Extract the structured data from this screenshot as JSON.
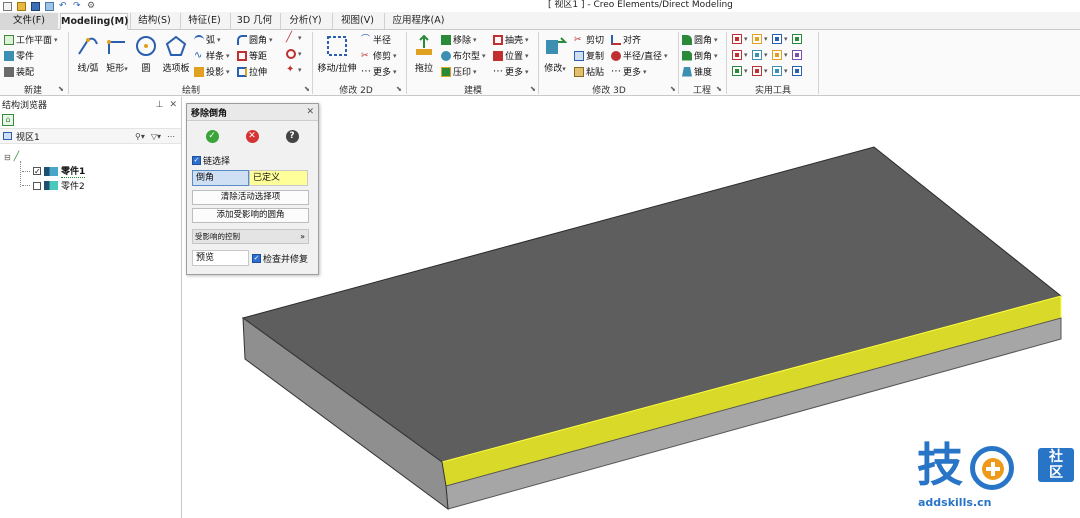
{
  "window": {
    "title": "[ 视区1 ] - Creo Elements/Direct Modeling"
  },
  "tabs": [
    {
      "label": "文件(F)"
    },
    {
      "label": "Modeling(M)"
    },
    {
      "label": "结构(S)"
    },
    {
      "label": "特征(E)"
    },
    {
      "label": "3D 几何"
    },
    {
      "label": "分析(Y)"
    },
    {
      "label": "视图(V)"
    },
    {
      "label": "应用程序(A)"
    }
  ],
  "ribbon": {
    "new": {
      "workplane": "工作平面",
      "part": "零件",
      "assembly": "装配",
      "label": "新建"
    },
    "draw": {
      "line_arc": "线/弧",
      "rectangle": "矩形",
      "circle": "圆",
      "options": "选项板",
      "arc": "弧",
      "spline": "样条",
      "project": "投影",
      "fillet": "圆角",
      "offset": "等距",
      "extrude": "拉伸",
      "label": "绘制"
    },
    "modify2d": {
      "move_stretch": "移动/拉伸",
      "radius": "半径",
      "trim": "修剪",
      "more": "更多",
      "label": "修改 2D"
    },
    "model": {
      "pull": "拖拉",
      "move": "移除",
      "boolean": "布尔型",
      "imprint": "压印",
      "shell": "抽壳",
      "position": "位置",
      "more": "更多",
      "label": "建模"
    },
    "modify3d": {
      "modify": "修改",
      "cut": "剪切",
      "copy": "复制",
      "paste": "粘贴",
      "align": "对齐",
      "radius_diameter": "半径/直径",
      "more": "更多",
      "label": "修改 3D"
    },
    "engineering": {
      "fillet": "圆角",
      "chamfer": "倒角",
      "taper": "锥度",
      "label": "工程"
    },
    "utilities": {
      "label": "实用工具"
    }
  },
  "browser": {
    "title": "结构浏览器",
    "viewport": "视区1",
    "parts": [
      {
        "label": "零件1",
        "checked": true
      },
      {
        "label": "零件2",
        "checked": false
      }
    ]
  },
  "dialog": {
    "title": "移除倒角",
    "chain_select": "链选择",
    "field_label": "倒角",
    "field_value": "已定义",
    "clear_button": "清除活动选择项",
    "add_button": "添加受影响的圆角",
    "section": "受影响的控制",
    "preview": "预览",
    "check_repair": "检查并修复"
  },
  "watermark": {
    "brand": "技",
    "badge": "社区",
    "url": "addskills.cn"
  },
  "colors": {
    "top_face": "#5e5e5e",
    "side_face": "#a6a6a6",
    "chamfer": "#d9d92a",
    "chamfer_outline": "#ffff40",
    "accent": "#2874c6"
  }
}
